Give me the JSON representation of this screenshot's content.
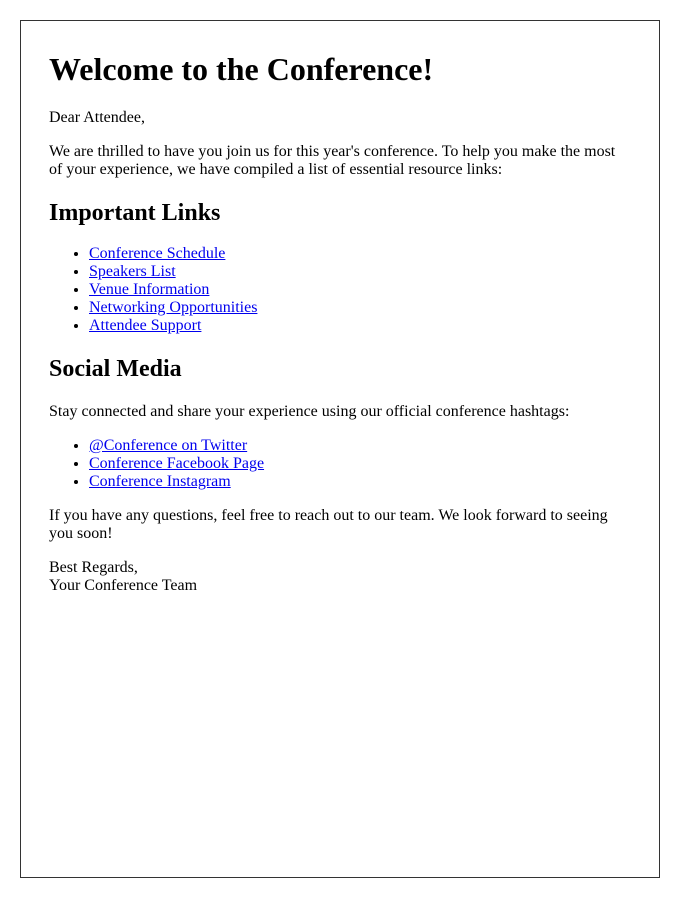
{
  "title": "Welcome to the Conference!",
  "greeting": "Dear Attendee,",
  "intro": "We are thrilled to have you join us for this year's conference. To help you make the most of your experience, we have compiled a list of essential resource links:",
  "important_links": {
    "heading": "Important Links",
    "items": [
      {
        "label": "Conference Schedule"
      },
      {
        "label": "Speakers List"
      },
      {
        "label": "Venue Information"
      },
      {
        "label": "Networking Opportunities"
      },
      {
        "label": "Attendee Support"
      }
    ]
  },
  "social_media": {
    "heading": "Social Media",
    "text": "Stay connected and share your experience using our official conference hashtags:",
    "items": [
      {
        "label": "@Conference on Twitter"
      },
      {
        "label": "Conference Facebook Page"
      },
      {
        "label": "Conference Instagram"
      }
    ]
  },
  "closing": "If you have any questions, feel free to reach out to our team. We look forward to seeing you soon!",
  "signoff": "Best Regards,",
  "signature": "Your Conference Team",
  "colors": {
    "link": "#0000ee",
    "border": "#333333"
  }
}
